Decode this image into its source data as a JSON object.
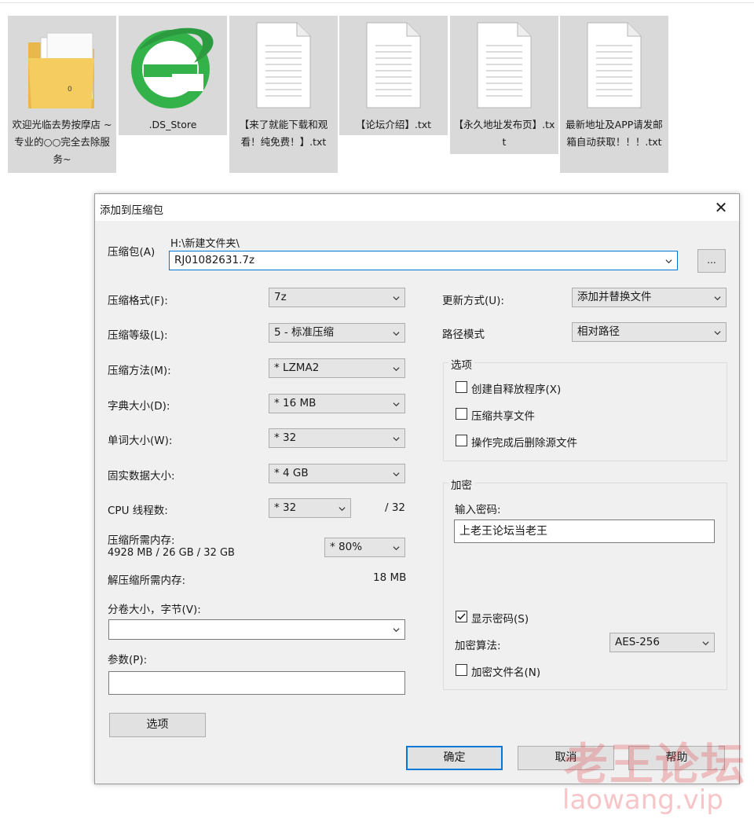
{
  "files": [
    {
      "name": "欢迎光临去势按摩店 ~专业的○○完全去除服务~",
      "icon": "folder-icon"
    },
    {
      "name": ".DS_Store",
      "icon": "browser-e-icon"
    },
    {
      "name": "【来了就能下载和观看！纯免费！】.txt",
      "icon": "text-file-icon"
    },
    {
      "name": "【论坛介绍】.txt",
      "icon": "text-file-icon"
    },
    {
      "name": "【永久地址发布页】.txt",
      "icon": "text-file-icon"
    },
    {
      "name": "最新地址及APP请发邮箱自动获取！！！.txt",
      "icon": "text-file-icon"
    }
  ],
  "dialog": {
    "title": "添加到压缩包",
    "close_glyph": "✕",
    "archive_label": "压缩包(A)",
    "archive_path": "H:\\新建文件夹\\",
    "archive_name": "RJ01082631.7z",
    "browse_label": "...",
    "left": {
      "format_label": "压缩格式(F):",
      "format_value": "7z",
      "level_label": "压缩等级(L):",
      "level_value": "5 - 标准压缩",
      "method_label": "压缩方法(M):",
      "method_value": "* LZMA2",
      "dict_label": "字典大小(D):",
      "dict_value": "* 16 MB",
      "word_label": "单词大小(W):",
      "word_value": "* 32",
      "solid_label": "固实数据大小:",
      "solid_value": "* 4 GB",
      "cpu_label": "CPU 线程数:",
      "cpu_value": "* 32",
      "cpu_max": "/ 32",
      "mem_label": "压缩所需内存:",
      "mem_value": "4928 MB / 26 GB / 32 GB",
      "mem_percent": "* 80%",
      "decomp_label": "解压缩所需内存:",
      "decomp_value": "18 MB",
      "volume_label": "分卷大小，字节(V):",
      "volume_value": "",
      "params_label": "参数(P):",
      "params_value": "",
      "options_button": "选项"
    },
    "right": {
      "update_label": "更新方式(U):",
      "update_value": "添加并替换文件",
      "path_label": "路径模式",
      "path_value": "相对路径",
      "options_group": "选项",
      "opt_sfx": "创建自释放程序(X)",
      "opt_shared": "压缩共享文件",
      "opt_delete": "操作完成后删除源文件",
      "encrypt_group": "加密",
      "password_label": "输入密码:",
      "password_value": "上老王论坛当老王",
      "show_password": "显示密码(S)",
      "algo_label": "加密算法:",
      "algo_value": "AES-256",
      "encrypt_names": "加密文件名(N)"
    },
    "buttons": {
      "ok": "确定",
      "cancel": "取消",
      "help": "帮助"
    }
  },
  "watermark": {
    "cn": "老王论坛",
    "en": "laowang.vip"
  }
}
